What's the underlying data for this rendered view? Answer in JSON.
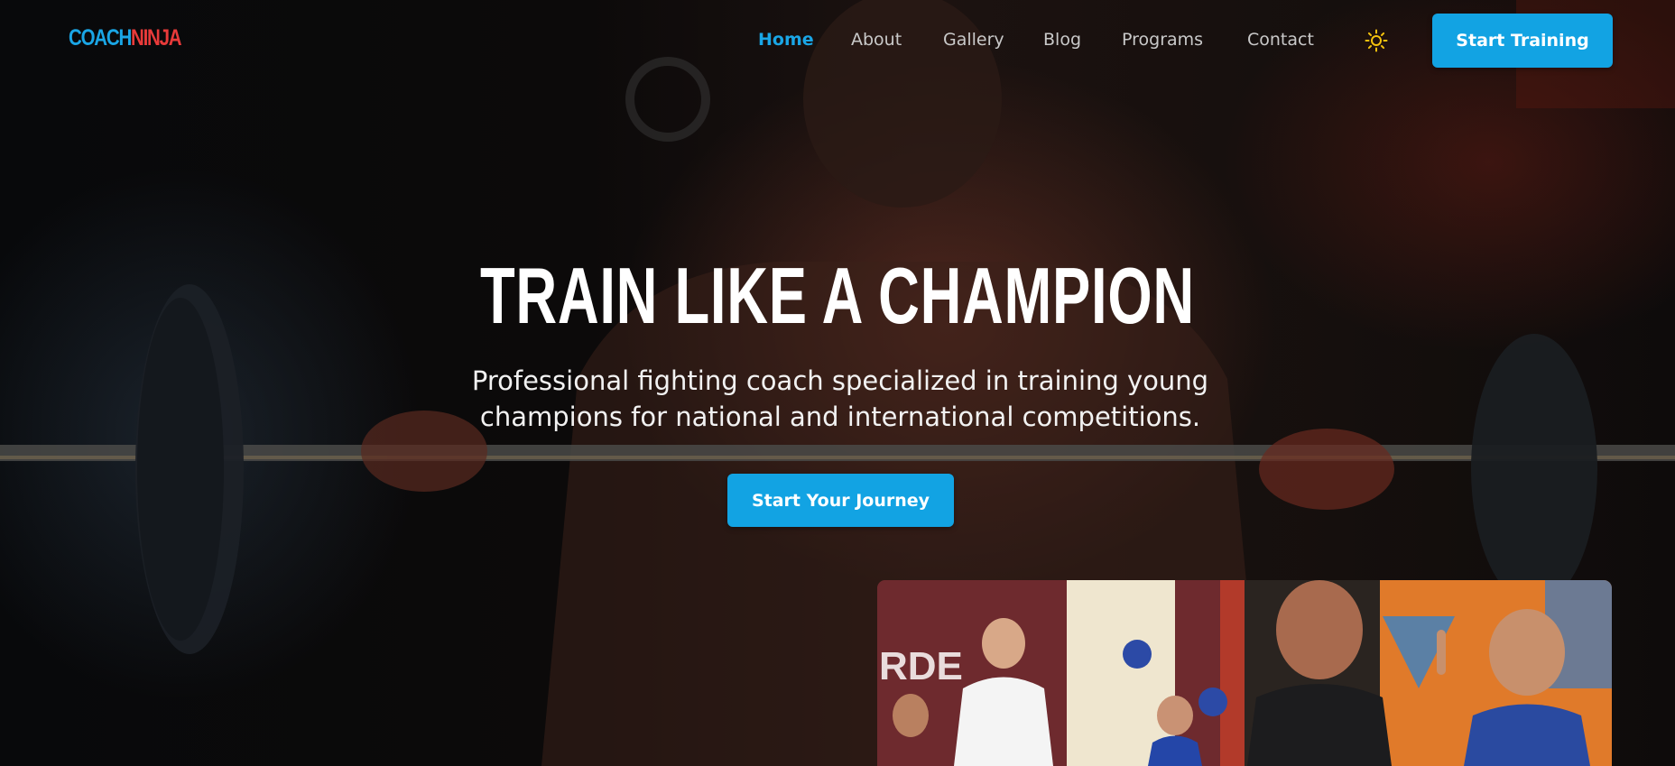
{
  "header": {
    "logo": {
      "part1": "COACH",
      "part2": "NINJA"
    },
    "nav": [
      "Home",
      "About",
      "Gallery",
      "Blog",
      "Programs",
      "Contact"
    ],
    "active_nav": "Home",
    "theme_toggle_icon": "sun-icon",
    "cta_label": "Start Training"
  },
  "hero": {
    "title": "TRAIN LIKE A CHAMPION",
    "subtitle_line1": "Professional fighting coach specialized in training young",
    "subtitle_line2": "champions for national and international competitions.",
    "cta_label": "Start Your Journey"
  },
  "photo": {
    "visible_sign_text": "RDE"
  },
  "colors": {
    "accent": "#12a3e3",
    "active_nav": "#1aa6e6",
    "logo_blue": "#1aa6e6",
    "logo_red": "#e83a3a"
  }
}
